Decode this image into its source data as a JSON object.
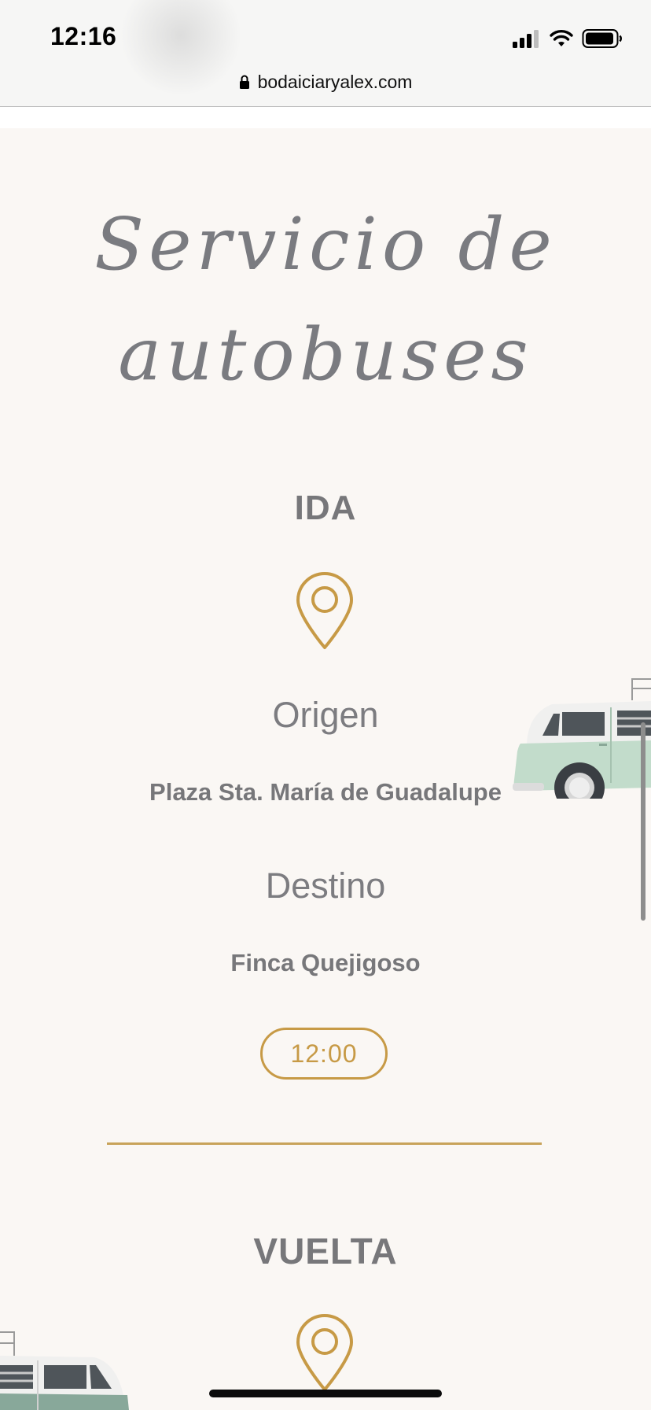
{
  "status_bar": {
    "time": "12:16",
    "icons": [
      "signal-icon",
      "wifi-icon",
      "battery-icon"
    ]
  },
  "browser": {
    "url": "bodaiciaryalex.com",
    "lock_icon": "lock-icon"
  },
  "page": {
    "title_line1": "Servicio de",
    "title_line2": "autobuses",
    "ida": {
      "heading": "IDA",
      "origin_label": "Origen",
      "origin_place": "Plaza Sta. María de Guadalupe",
      "destination_label": "Destino",
      "destination_place": "Finca Quejigoso",
      "time": "12:00"
    },
    "vuelta": {
      "heading": "VUELTA"
    }
  },
  "colors": {
    "background": "#faf7f4",
    "accent_gold": "#c79a46",
    "text_gray": "#77777a",
    "van_green": "#c2dccb"
  }
}
